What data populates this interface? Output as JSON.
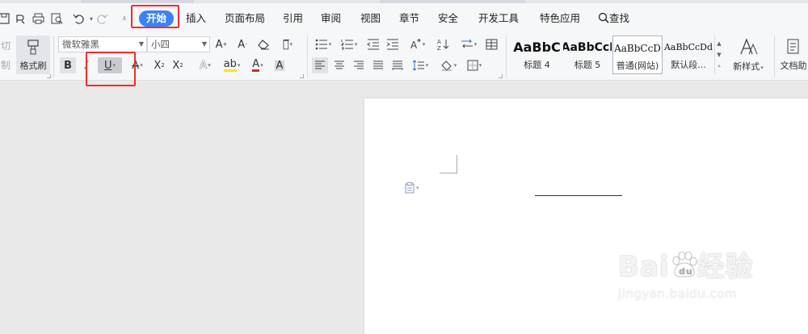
{
  "menu": {
    "items": [
      {
        "label": "开始",
        "active": true
      },
      {
        "label": "插入"
      },
      {
        "label": "页面布局"
      },
      {
        "label": "引用"
      },
      {
        "label": "审阅"
      },
      {
        "label": "视图"
      },
      {
        "label": "章节"
      },
      {
        "label": "安全"
      },
      {
        "label": "开发工具"
      },
      {
        "label": "特色应用"
      }
    ],
    "search_label": "查找",
    "accent": "#3b82f6"
  },
  "clipboard": {
    "cut_fragment": "切",
    "copy_fragment": "制",
    "format_painter": "格式刷"
  },
  "font": {
    "name": "微软雅黑",
    "size": "小四"
  },
  "styles": {
    "cards": [
      {
        "sample": "AaBbC",
        "name": "标题 4"
      },
      {
        "sample": "AaBbCcI",
        "name": "标题 5"
      },
      {
        "sample": "AaBbCcD",
        "name": "普通(网站)"
      },
      {
        "sample": "AaBbCcDd",
        "name": "默认段..."
      }
    ],
    "new_style": "新样式",
    "doc_tools_fragment": "文档助"
  },
  "highlight_box_color": "#ec2f2f",
  "watermark": {
    "brand": "Bai",
    "brand_tail": "经验",
    "url": "jingyan.baidu.com"
  }
}
